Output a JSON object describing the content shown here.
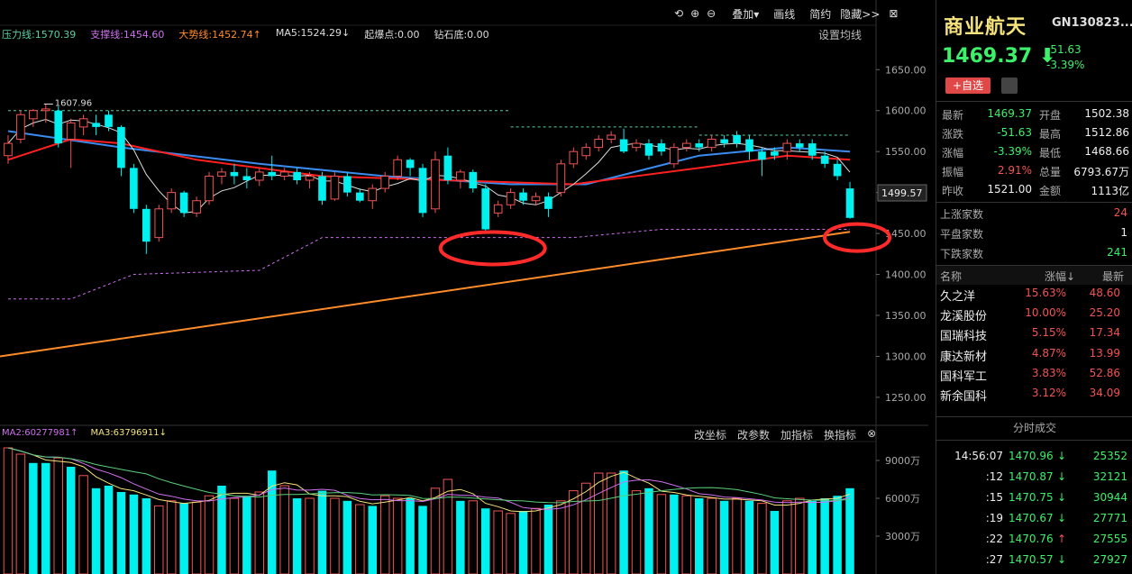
{
  "toolbar": {
    "overlay": "叠加",
    "draw": "画线",
    "period": "简约",
    "hide": "隐藏>>",
    "set_ma": "设置均线"
  },
  "indicators": {
    "pressure": "压力线:1570.39",
    "support": "支撑线:1454.60",
    "trend": "大势线:1452.74↑",
    "ma5": "MA5:1524.29↓",
    "start_point": "起爆点:0.00",
    "diamond": "钻石底:0.00",
    "peak_label": "1607.96",
    "current_label": "1499.57"
  },
  "volume_indicators": {
    "ma2": "MA2:60277981↑",
    "ma3": "MA3:63796911↓",
    "links": [
      "改坐标",
      "改参数",
      "加指标",
      "换指标"
    ]
  },
  "colors": {
    "up": "#f35353",
    "down": "#00f0f0",
    "pressure": "#5ad1a0",
    "support": "#d070f0",
    "trend": "#ff8c2a",
    "ma_red": "#ff2020",
    "ma_blue": "#3a8cf0",
    "ma_thin": "#dddddd",
    "accent": "#f5e27a"
  },
  "chart_data": [
    {
      "type": "candlestick",
      "y_ticks": [
        "1650.00",
        "1600.00",
        "1550.00",
        "1500.00",
        "1450.00",
        "1400.00",
        "1350.00",
        "1300.00",
        "1250.00"
      ],
      "ylim": [
        1218,
        1680
      ],
      "candles": [
        {
          "o": 1545,
          "c": 1560,
          "h": 1570,
          "l": 1535
        },
        {
          "o": 1565,
          "c": 1595,
          "h": 1600,
          "l": 1560
        },
        {
          "o": 1590,
          "c": 1600,
          "h": 1602,
          "l": 1580
        },
        {
          "o": 1600,
          "c": 1602,
          "h": 1608,
          "l": 1585
        },
        {
          "o": 1600,
          "c": 1560,
          "h": 1605,
          "l": 1555
        },
        {
          "o": 1565,
          "c": 1585,
          "h": 1590,
          "l": 1530
        },
        {
          "o": 1580,
          "c": 1590,
          "h": 1595,
          "l": 1570
        },
        {
          "o": 1585,
          "c": 1580,
          "h": 1595,
          "l": 1570
        },
        {
          "o": 1595,
          "c": 1580,
          "h": 1600,
          "l": 1575
        },
        {
          "o": 1580,
          "c": 1530,
          "h": 1582,
          "l": 1520
        },
        {
          "o": 1530,
          "c": 1480,
          "h": 1535,
          "l": 1475
        },
        {
          "o": 1480,
          "c": 1440,
          "h": 1485,
          "l": 1425
        },
        {
          "o": 1445,
          "c": 1480,
          "h": 1485,
          "l": 1440
        },
        {
          "o": 1480,
          "c": 1500,
          "h": 1505,
          "l": 1475
        },
        {
          "o": 1500,
          "c": 1475,
          "h": 1502,
          "l": 1470
        },
        {
          "o": 1475,
          "c": 1490,
          "h": 1495,
          "l": 1470
        },
        {
          "o": 1490,
          "c": 1520,
          "h": 1525,
          "l": 1485
        },
        {
          "o": 1520,
          "c": 1525,
          "h": 1530,
          "l": 1510
        },
        {
          "o": 1525,
          "c": 1520,
          "h": 1535,
          "l": 1510
        },
        {
          "o": 1520,
          "c": 1515,
          "h": 1530,
          "l": 1505
        },
        {
          "o": 1515,
          "c": 1525,
          "h": 1530,
          "l": 1508
        },
        {
          "o": 1525,
          "c": 1520,
          "h": 1545,
          "l": 1515
        },
        {
          "o": 1520,
          "c": 1525,
          "h": 1530,
          "l": 1515
        },
        {
          "o": 1525,
          "c": 1515,
          "h": 1530,
          "l": 1510
        },
        {
          "o": 1515,
          "c": 1520,
          "h": 1525,
          "l": 1505
        },
        {
          "o": 1520,
          "c": 1490,
          "h": 1525,
          "l": 1485
        },
        {
          "o": 1492,
          "c": 1520,
          "h": 1525,
          "l": 1490
        },
        {
          "o": 1520,
          "c": 1500,
          "h": 1525,
          "l": 1495
        },
        {
          "o": 1500,
          "c": 1490,
          "h": 1505,
          "l": 1488
        },
        {
          "o": 1490,
          "c": 1505,
          "h": 1510,
          "l": 1480
        },
        {
          "o": 1505,
          "c": 1520,
          "h": 1525,
          "l": 1500
        },
        {
          "o": 1520,
          "c": 1540,
          "h": 1545,
          "l": 1515
        },
        {
          "o": 1540,
          "c": 1530,
          "h": 1542,
          "l": 1520
        },
        {
          "o": 1530,
          "c": 1475,
          "h": 1535,
          "l": 1470
        },
        {
          "o": 1480,
          "c": 1540,
          "h": 1550,
          "l": 1475
        },
        {
          "o": 1545,
          "c": 1515,
          "h": 1555,
          "l": 1510
        },
        {
          "o": 1515,
          "c": 1525,
          "h": 1528,
          "l": 1505
        },
        {
          "o": 1525,
          "c": 1505,
          "h": 1528,
          "l": 1500
        },
        {
          "o": 1505,
          "c": 1455,
          "h": 1510,
          "l": 1452
        },
        {
          "o": 1475,
          "c": 1485,
          "h": 1490,
          "l": 1470
        },
        {
          "o": 1485,
          "c": 1500,
          "h": 1505,
          "l": 1480
        },
        {
          "o": 1500,
          "c": 1490,
          "h": 1505,
          "l": 1485
        },
        {
          "o": 1490,
          "c": 1495,
          "h": 1500,
          "l": 1485
        },
        {
          "o": 1495,
          "c": 1480,
          "h": 1500,
          "l": 1470
        },
        {
          "o": 1500,
          "c": 1535,
          "h": 1540,
          "l": 1495
        },
        {
          "o": 1535,
          "c": 1550,
          "h": 1555,
          "l": 1530
        },
        {
          "o": 1545,
          "c": 1555,
          "h": 1560,
          "l": 1540
        },
        {
          "o": 1555,
          "c": 1565,
          "h": 1570,
          "l": 1550
        },
        {
          "o": 1565,
          "c": 1570,
          "h": 1575,
          "l": 1560
        },
        {
          "o": 1565,
          "c": 1550,
          "h": 1578,
          "l": 1548
        },
        {
          "o": 1555,
          "c": 1560,
          "h": 1565,
          "l": 1550
        },
        {
          "o": 1560,
          "c": 1545,
          "h": 1565,
          "l": 1540
        },
        {
          "o": 1560,
          "c": 1550,
          "h": 1565,
          "l": 1545
        },
        {
          "o": 1535,
          "c": 1555,
          "h": 1560,
          "l": 1530
        },
        {
          "o": 1555,
          "c": 1560,
          "h": 1565,
          "l": 1550
        },
        {
          "o": 1560,
          "c": 1555,
          "h": 1565,
          "l": 1550
        },
        {
          "o": 1555,
          "c": 1565,
          "h": 1570,
          "l": 1550
        },
        {
          "o": 1565,
          "c": 1560,
          "h": 1570,
          "l": 1555
        },
        {
          "o": 1570,
          "c": 1560,
          "h": 1575,
          "l": 1555
        },
        {
          "o": 1565,
          "c": 1550,
          "h": 1570,
          "l": 1540
        },
        {
          "o": 1550,
          "c": 1540,
          "h": 1555,
          "l": 1520
        },
        {
          "o": 1550,
          "c": 1545,
          "h": 1555,
          "l": 1540
        },
        {
          "o": 1550,
          "c": 1560,
          "h": 1565,
          "l": 1540
        },
        {
          "o": 1560,
          "c": 1555,
          "h": 1565,
          "l": 1550
        },
        {
          "o": 1560,
          "c": 1545,
          "h": 1565,
          "l": 1540
        },
        {
          "o": 1545,
          "c": 1535,
          "h": 1550,
          "l": 1530
        },
        {
          "o": 1535,
          "c": 1520,
          "h": 1540,
          "l": 1515
        },
        {
          "o": 1505,
          "c": 1469,
          "h": 1513,
          "l": 1468
        }
      ],
      "pressure_line": {
        "segments": [
          [
            0,
            40,
            1600
          ],
          [
            40,
            55,
            1580
          ],
          [
            55,
            67,
            1570
          ]
        ]
      },
      "support_line": {
        "points": [
          [
            0,
            1370
          ],
          [
            5,
            1370
          ],
          [
            10,
            1400
          ],
          [
            20,
            1405
          ],
          [
            25,
            1445
          ],
          [
            45,
            1445
          ],
          [
            52,
            1455
          ],
          [
            67,
            1455
          ]
        ]
      },
      "trend_line": {
        "start": [
          0,
          1300
        ],
        "end": [
          67,
          1452
        ]
      },
      "ma_red": [
        [
          0,
          1540
        ],
        [
          5,
          1565
        ],
        [
          9,
          1560
        ],
        [
          15,
          1540
        ],
        [
          25,
          1520
        ],
        [
          35,
          1515
        ],
        [
          45,
          1510
        ],
        [
          55,
          1530
        ],
        [
          62,
          1545
        ],
        [
          67,
          1540
        ]
      ],
      "ma_blue": [
        [
          0,
          1575
        ],
        [
          9,
          1555
        ],
        [
          20,
          1535
        ],
        [
          30,
          1520
        ],
        [
          40,
          1510
        ],
        [
          46,
          1510
        ],
        [
          55,
          1545
        ],
        [
          62,
          1555
        ],
        [
          67,
          1550
        ]
      ]
    },
    {
      "type": "bar",
      "name": "volume",
      "y_ticks": [
        "9000万",
        "6000万",
        "3000万"
      ],
      "ylim": [
        0,
        10500
      ],
      "values": [
        {
          "v": 10000,
          "up": true
        },
        {
          "v": 9500,
          "up": true
        },
        {
          "v": 8800,
          "up": false
        },
        {
          "v": 8800,
          "up": false
        },
        {
          "v": 9200,
          "up": true
        },
        {
          "v": 8500,
          "up": false
        },
        {
          "v": 7800,
          "up": true
        },
        {
          "v": 6800,
          "up": false
        },
        {
          "v": 7000,
          "up": false
        },
        {
          "v": 6500,
          "up": false
        },
        {
          "v": 6300,
          "up": false
        },
        {
          "v": 6000,
          "up": false
        },
        {
          "v": 5400,
          "up": true
        },
        {
          "v": 5800,
          "up": true
        },
        {
          "v": 5600,
          "up": false
        },
        {
          "v": 5700,
          "up": true
        },
        {
          "v": 6200,
          "up": true
        },
        {
          "v": 7000,
          "up": false
        },
        {
          "v": 6000,
          "up": true
        },
        {
          "v": 6200,
          "up": false
        },
        {
          "v": 6500,
          "up": true
        },
        {
          "v": 8200,
          "up": false
        },
        {
          "v": 7000,
          "up": true
        },
        {
          "v": 6000,
          "up": false
        },
        {
          "v": 6000,
          "up": true
        },
        {
          "v": 6600,
          "up": false
        },
        {
          "v": 6000,
          "up": true
        },
        {
          "v": 5800,
          "up": false
        },
        {
          "v": 5500,
          "up": true
        },
        {
          "v": 5400,
          "up": false
        },
        {
          "v": 6200,
          "up": true
        },
        {
          "v": 6000,
          "up": true
        },
        {
          "v": 6000,
          "up": false
        },
        {
          "v": 5400,
          "up": false
        },
        {
          "v": 6800,
          "up": true
        },
        {
          "v": 7500,
          "up": true
        },
        {
          "v": 5800,
          "up": false
        },
        {
          "v": 5800,
          "up": true
        },
        {
          "v": 5200,
          "up": false
        },
        {
          "v": 5000,
          "up": true
        },
        {
          "v": 4800,
          "up": true
        },
        {
          "v": 5000,
          "up": false
        },
        {
          "v": 5200,
          "up": true
        },
        {
          "v": 5500,
          "up": false
        },
        {
          "v": 5800,
          "up": true
        },
        {
          "v": 6600,
          "up": true
        },
        {
          "v": 7200,
          "up": true
        },
        {
          "v": 8000,
          "up": true
        },
        {
          "v": 8000,
          "up": true
        },
        {
          "v": 8200,
          "up": false
        },
        {
          "v": 6600,
          "up": true
        },
        {
          "v": 6800,
          "up": false
        },
        {
          "v": 6300,
          "up": true
        },
        {
          "v": 6300,
          "up": false
        },
        {
          "v": 6200,
          "up": true
        },
        {
          "v": 6000,
          "up": false
        },
        {
          "v": 6000,
          "up": true
        },
        {
          "v": 5800,
          "up": false
        },
        {
          "v": 6000,
          "up": true
        },
        {
          "v": 5800,
          "up": false
        },
        {
          "v": 5600,
          "up": true
        },
        {
          "v": 5000,
          "up": false
        },
        {
          "v": 5800,
          "up": true
        },
        {
          "v": 6000,
          "up": true
        },
        {
          "v": 5800,
          "up": false
        },
        {
          "v": 6000,
          "up": false
        },
        {
          "v": 6200,
          "up": false
        },
        {
          "v": 6800,
          "up": false
        }
      ]
    }
  ],
  "panel": {
    "name": "商业航天",
    "code": "GN130823...",
    "price": "1469.37",
    "change": "-51.63",
    "change_pct": "-3.39%",
    "add_fav": "+自选",
    "quote": [
      {
        "l1": "最新",
        "v1": "1469.37",
        "c1": "green",
        "l2": "开盘",
        "v2": "1502.38",
        "c2": "white"
      },
      {
        "l1": "涨跌",
        "v1": "-51.63",
        "c1": "green",
        "l2": "最高",
        "v2": "1512.86",
        "c2": "white"
      },
      {
        "l1": "涨幅",
        "v1": "-3.39%",
        "c1": "green",
        "l2": "最低",
        "v2": "1468.66",
        "c2": "white"
      },
      {
        "l1": "振幅",
        "v1": "2.91%",
        "c1": "red",
        "l2": "总量",
        "v2": "6793.67万",
        "c2": "white"
      },
      {
        "l1": "昨收",
        "v1": "1521.00",
        "c1": "white",
        "l2": "金额",
        "v2": "1113亿",
        "c2": "white"
      }
    ],
    "breadth": [
      {
        "label": "上涨家数",
        "value": "24",
        "c": "red"
      },
      {
        "label": "平盘家数",
        "value": "1",
        "c": "white"
      },
      {
        "label": "下跌家数",
        "value": "241",
        "c": "green"
      }
    ],
    "stock_header": {
      "name": "名称",
      "pct": "涨幅↓",
      "latest": "最新"
    },
    "stocks": [
      {
        "name": "久之洋",
        "pct": "15.63%",
        "latest": "48.60"
      },
      {
        "name": "龙溪股份",
        "pct": "10.00%",
        "latest": "25.20"
      },
      {
        "name": "国瑞科技",
        "pct": "5.15%",
        "latest": "17.34"
      },
      {
        "name": "康达新材",
        "pct": "4.87%",
        "latest": "13.99"
      },
      {
        "name": "国科军工",
        "pct": "3.83%",
        "latest": "52.86"
      },
      {
        "name": "新余国科",
        "pct": "3.12%",
        "latest": "34.09"
      }
    ],
    "trades_title": "分时成交",
    "trades": [
      {
        "time": "14:56:07",
        "price": "1470.96",
        "dir": "↓",
        "dc": "green",
        "vol": "25352"
      },
      {
        "time": ":12",
        "price": "1470.87",
        "dir": "↓",
        "dc": "green",
        "vol": "32121"
      },
      {
        "time": ":15",
        "price": "1470.75",
        "dir": "↓",
        "dc": "green",
        "vol": "30944"
      },
      {
        "time": ":19",
        "price": "1470.67",
        "dir": "↓",
        "dc": "green",
        "vol": "27771"
      },
      {
        "time": ":22",
        "price": "1470.76",
        "dir": "↑",
        "dc": "red",
        "vol": "27555"
      },
      {
        "time": ":27",
        "price": "1470.57",
        "dir": "↓",
        "dc": "green",
        "vol": "27927"
      }
    ]
  }
}
